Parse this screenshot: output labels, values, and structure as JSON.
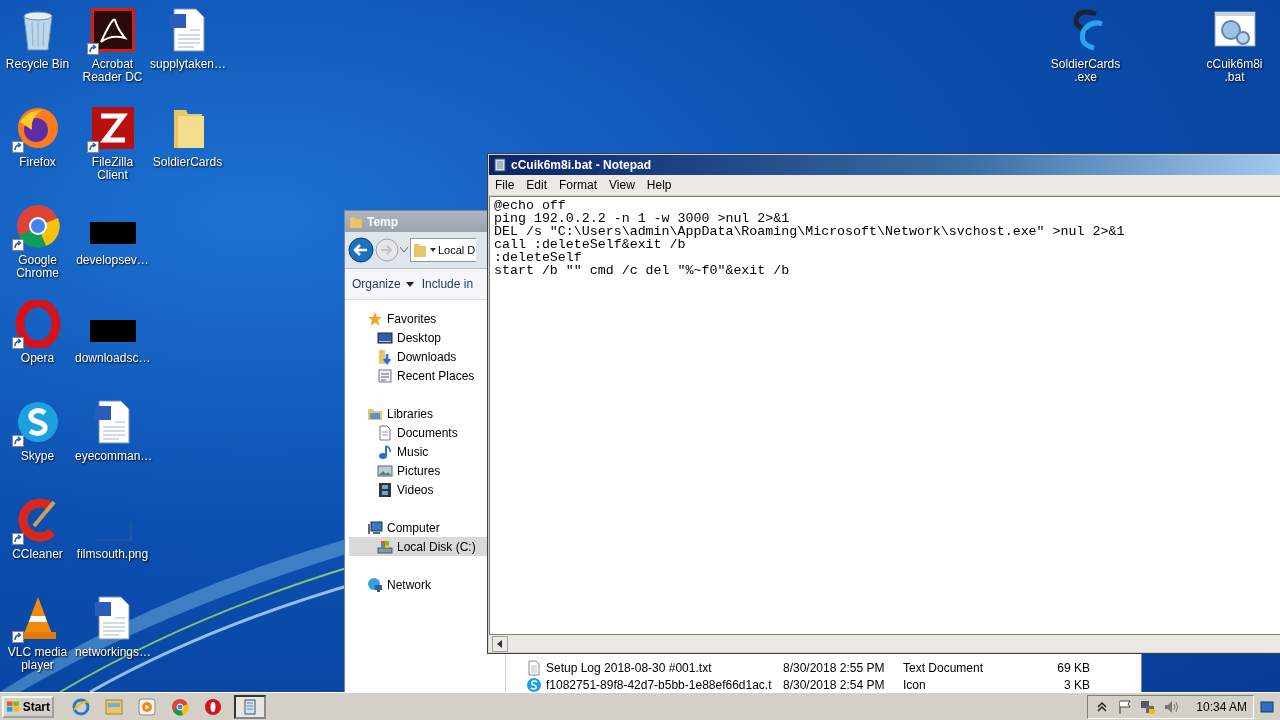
{
  "desktop_icons": [
    {
      "label": "Recycle Bin",
      "kind": "recycle-bin",
      "shortcut": false
    },
    {
      "label": "Acrobat Reader DC",
      "kind": "pdf-reader",
      "shortcut": true
    },
    {
      "label": "supplytaken…",
      "kind": "word-doc",
      "shortcut": false
    },
    {
      "label": "Firefox",
      "kind": "firefox",
      "shortcut": true
    },
    {
      "label": "FileZilla Client",
      "kind": "filezilla",
      "shortcut": true
    },
    {
      "label": "SoldierCards",
      "kind": "folder",
      "shortcut": false
    },
    {
      "label": "Google Chrome",
      "kind": "chrome",
      "shortcut": true
    },
    {
      "label": "developsev…",
      "kind": "dark-image",
      "shortcut": false
    },
    {
      "label": "Opera",
      "kind": "opera",
      "shortcut": true
    },
    {
      "label": "downloadsc…",
      "kind": "dark-image",
      "shortcut": false
    },
    {
      "label": "Skype",
      "kind": "skype",
      "shortcut": true
    },
    {
      "label": "eyecomman…",
      "kind": "word-doc",
      "shortcut": false
    },
    {
      "label": "CCleaner",
      "kind": "ccleaner",
      "shortcut": true
    },
    {
      "label": "filmsouth.png",
      "kind": "blank-image",
      "shortcut": false
    },
    {
      "label": "VLC media player",
      "kind": "vlc",
      "shortcut": true
    },
    {
      "label": "networkings…",
      "kind": "word-doc",
      "shortcut": false
    }
  ],
  "desktop_icons_right": [
    {
      "label": "SoldierCards.exe",
      "kind": "app-logo"
    },
    {
      "label": "cCuik6m8i.bat",
      "kind": "batch-file"
    }
  ],
  "explorer": {
    "title": "Temp",
    "address": "Local D",
    "toolbar": [
      {
        "label": "Organize",
        "dropdown": true
      },
      {
        "label": "Include in",
        "dropdown": false
      }
    ],
    "nav": [
      {
        "label": "Favorites",
        "kind": "star",
        "selected": false,
        "children": [
          {
            "label": "Desktop",
            "kind": "desktop",
            "selected": false
          },
          {
            "label": "Downloads",
            "kind": "downloads",
            "selected": false
          },
          {
            "label": "Recent Places",
            "kind": "recent",
            "selected": false
          }
        ]
      },
      {
        "label": "Libraries",
        "kind": "library",
        "selected": false,
        "children": [
          {
            "label": "Documents",
            "kind": "documents",
            "selected": false
          },
          {
            "label": "Music",
            "kind": "music",
            "selected": false
          },
          {
            "label": "Pictures",
            "kind": "pictures",
            "selected": false
          },
          {
            "label": "Videos",
            "kind": "videos",
            "selected": false
          }
        ]
      },
      {
        "label": "Computer",
        "kind": "computer",
        "selected": false,
        "children": [
          {
            "label": "Local Disk (C:)",
            "kind": "disk",
            "selected": true
          }
        ]
      },
      {
        "label": "Network",
        "kind": "network",
        "selected": false
      }
    ],
    "files": [
      {
        "name": "Setup Log 2018-08-30 #001.txt",
        "kind": "text",
        "date": "8/30/2018 2:55 PM",
        "type": "Text Document",
        "size": "69 KB"
      },
      {
        "name": "f1082751-89f8-42d7-b5bb-1e88ef66d1ac.t",
        "kind": "skype",
        "date": "8/30/2018 2:54 PM",
        "type": "Icon",
        "size": "3 KB"
      }
    ]
  },
  "notepad": {
    "title": "cCuik6m8i.bat - Notepad",
    "menu": [
      "File",
      "Edit",
      "Format",
      "View",
      "Help"
    ],
    "lines": [
      "@echo off",
      "ping 192.0.2.2 -n 1 -w 3000 >nul 2>&1",
      "DEL /s \"C:\\Users\\admin\\AppData\\Roaming\\Microsoft\\Network\\svchost.exe\" >nul 2>&1",
      "call :deleteSelf&exit /b",
      ":deleteSelf",
      "start /b \"\" cmd /c del \"%~f0\"&exit /b"
    ]
  },
  "taskbar": {
    "start": "Start",
    "launchers": [
      {
        "kind": "ie"
      },
      {
        "kind": "explorer"
      },
      {
        "kind": "media"
      },
      {
        "kind": "chrome"
      },
      {
        "kind": "opera"
      }
    ],
    "windows": [
      {
        "kind": "notepad",
        "selected": true
      }
    ],
    "tray": [
      {
        "kind": "chevron"
      },
      {
        "kind": "flag"
      },
      {
        "kind": "network"
      },
      {
        "kind": "speaker"
      }
    ],
    "clock": "10:34 AM"
  }
}
